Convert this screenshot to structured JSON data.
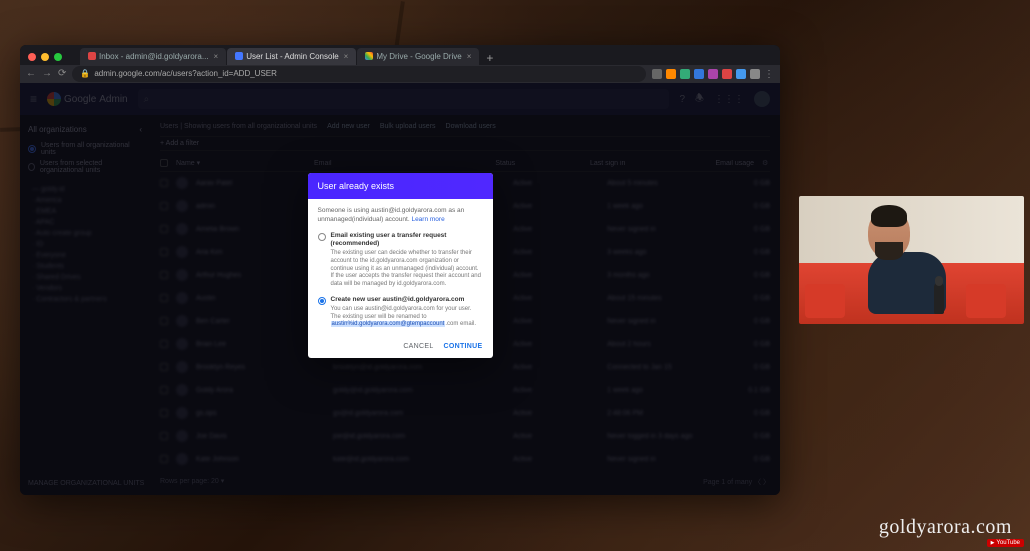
{
  "browser": {
    "tabs": [
      {
        "label": "Inbox - admin@id.goldyarora...",
        "favicon": "f-red"
      },
      {
        "label": "User List - Admin Console",
        "favicon": "f-blue",
        "active": true
      },
      {
        "label": "My Drive - Google Drive",
        "favicon": "f-gg"
      }
    ],
    "url": "admin.google.com/ac/users?action_id=ADD_USER"
  },
  "app": {
    "brand_a": "Google",
    "brand_b": "Admin",
    "search_placeholder": "Search for users, groups or settings"
  },
  "sidebar": {
    "heading": "All organizations",
    "opt_all": "Users from all organizational units",
    "opt_sel": "Users from selected organizational units",
    "tree": [
      "— goldy.id",
      "  · America",
      "  · EMEA",
      "  · APAC",
      "  · Auto create group",
      "  · ID",
      "  · Everyone",
      "  · Students",
      "  · Shared Drives",
      "  · Vendors",
      "  · Contractors & partners"
    ],
    "footer": "MANAGE ORGANIZATIONAL UNITS"
  },
  "main": {
    "crumbs": "Users | Showing users from all organizational units",
    "actions": [
      "Add new user",
      "Bulk upload users",
      "Download users"
    ],
    "subhead": "+ Add a filter",
    "cols": {
      "name": "Name ▾",
      "email": "Email",
      "status": "Status",
      "last": "Last sign in",
      "usage": "Email usage"
    },
    "rows": [
      {
        "n": "Aarav Patel",
        "e": "aarav@id.goldyarora.com",
        "s": "Active",
        "l": "About 5 minutes",
        "u": "0 GB"
      },
      {
        "n": "admin",
        "e": "admin@id.goldyarora.com",
        "s": "Active",
        "l": "1 week ago",
        "u": "0 GB"
      },
      {
        "n": "Amelia Brown",
        "e": "amelia@id.goldyarora.com",
        "s": "Active",
        "l": "Never signed in",
        "u": "0 GB"
      },
      {
        "n": "Aria Kim",
        "e": "aria@id.goldyarora.com",
        "s": "Active",
        "l": "3 weeks ago",
        "u": "0 GB"
      },
      {
        "n": "Arthur Hughes",
        "e": "arthur@id.goldyarora.com",
        "s": "Active",
        "l": "3 months ago",
        "u": "0 GB"
      },
      {
        "n": "Austin",
        "e": "austin@id.goldyarora.com",
        "s": "Active",
        "l": "About 15 minutes",
        "u": "0 GB"
      },
      {
        "n": "Ben Carter",
        "e": "ben@id.goldyarora.com",
        "s": "Active",
        "l": "Never signed in",
        "u": "0 GB"
      },
      {
        "n": "Brian Lee",
        "e": "brian@id.goldyarora.com",
        "s": "Active",
        "l": "About 2 hours",
        "u": "0 GB"
      },
      {
        "n": "Brooklyn Reyes",
        "e": "brooklyn@id.goldyarora.com",
        "s": "Active",
        "l": "Connected to Jan 15",
        "u": "0 GB"
      },
      {
        "n": "Goldy Arora",
        "e": "goldy@id.goldyarora.com",
        "s": "Active",
        "l": "1 week ago",
        "u": "0.1 GB"
      },
      {
        "n": "gs.ops",
        "e": "gs@id.goldyarora.com",
        "s": "Active",
        "l": "2:48:06 PM",
        "u": "0 GB"
      },
      {
        "n": "Joe Davis",
        "e": "joe@id.goldyarora.com",
        "s": "Active",
        "l": "Never logged in 3 days ago",
        "u": "0 GB"
      },
      {
        "n": "Kate Johnson",
        "e": "kate@id.goldyarora.com",
        "s": "Active",
        "l": "Never signed in",
        "u": "0 GB"
      }
    ],
    "footer_left": "Rows per page: 20 ▾",
    "footer_right": "Page 1 of many  〈  〉"
  },
  "modal": {
    "title": "User already exists",
    "intro_a": "Someone is using austin@id.goldyarora.com as an unmanaged(individual) account. ",
    "intro_link": "Learn more",
    "opt1_title": "Email existing user a transfer request (recommended)",
    "opt1_desc": "The existing user can decide whether to transfer their account to the id.goldyarora.com organization or continue using it as an unmanaged (individual) account. If the user accepts the transfer request their account and data will be managed by id.goldyarora.com.",
    "opt2_title": "Create new user austin@id.goldyarora.com",
    "opt2_desc_a": "You can use austin@id.goldyarora.com for your user. The existing user will be renamed to ",
    "opt2_hl": "austin%id.goldyarora.com@gtempaccount",
    "opt2_desc_b": ".com email.",
    "cancel": "CANCEL",
    "continue": "CONTINUE"
  },
  "watermark": "goldyarora.com",
  "yt_label": "YouTube"
}
